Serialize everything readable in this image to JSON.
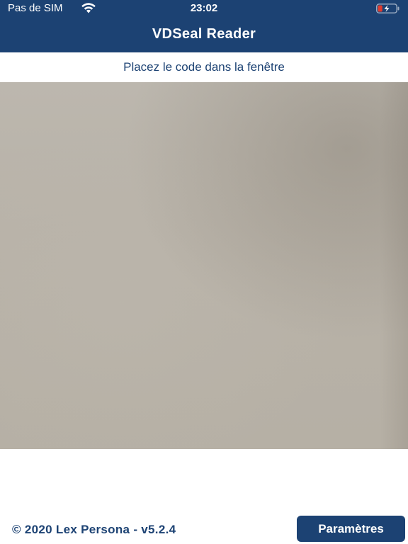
{
  "status_bar": {
    "carrier": "Pas de SIM",
    "time": "23:02",
    "wifi_icon": "wifi-icon",
    "battery_icon": "battery-charging-icon",
    "battery_level": 0.25
  },
  "header": {
    "title": "VDSeal Reader",
    "background_color": "#1c4273"
  },
  "instruction": "Placez le code dans la fenêtre",
  "footer": {
    "copyright": "© 2020 Lex Persona - v5.2.4",
    "settings_label": "Paramètres"
  },
  "colors": {
    "accent": "#1c4273",
    "camera_feed": "#b9b3a9"
  }
}
